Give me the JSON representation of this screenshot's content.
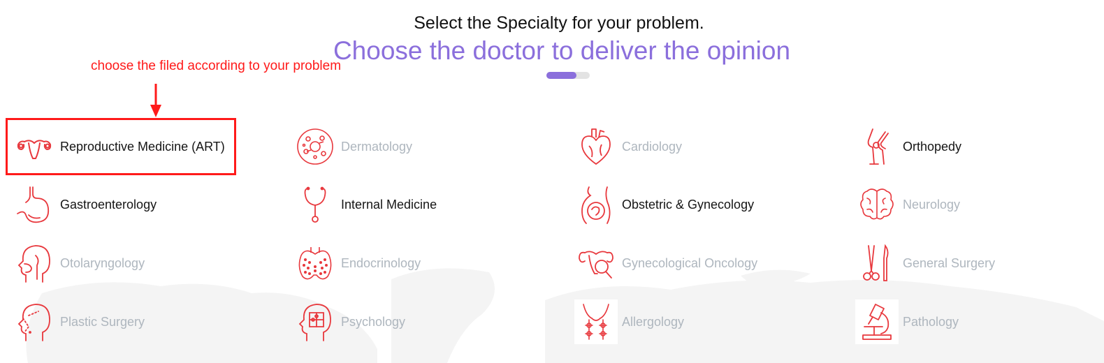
{
  "header": {
    "subtitle": "Select the Specialty for your problem.",
    "title": "Choose the doctor to deliver the opinion",
    "progress_fraction": 0.69
  },
  "annotation": {
    "text": "choose the filed according to your problem",
    "color": "#ff1a1a"
  },
  "colors": {
    "accent": "#8b6fdc",
    "icon": "#e8383d",
    "enabled_text": "#151515",
    "disabled_text": "#aeb6be"
  },
  "specialties": [
    {
      "label": "Reproductive Medicine (ART)",
      "icon": "uterus-icon",
      "enabled": true
    },
    {
      "label": "Dermatology",
      "icon": "skin-cells-icon",
      "enabled": false
    },
    {
      "label": "Cardiology",
      "icon": "heart-icon",
      "enabled": false
    },
    {
      "label": "Orthopedy",
      "icon": "knee-joint-icon",
      "enabled": true
    },
    {
      "label": "Gastroenterology",
      "icon": "stomach-icon",
      "enabled": true
    },
    {
      "label": "Internal Medicine",
      "icon": "stethoscope-icon",
      "enabled": true
    },
    {
      "label": "Obstetric & Gynecology",
      "icon": "pregnant-belly-icon",
      "enabled": true
    },
    {
      "label": "Neurology",
      "icon": "brain-icon",
      "enabled": false
    },
    {
      "label": "Otolaryngology",
      "icon": "head-throat-icon",
      "enabled": false
    },
    {
      "label": "Endocrinology",
      "icon": "thyroid-icon",
      "enabled": false
    },
    {
      "label": "Gynecological Oncology",
      "icon": "uterus-magnifier-icon",
      "enabled": false
    },
    {
      "label": "General Surgery",
      "icon": "surgical-tools-icon",
      "enabled": false
    },
    {
      "label": "Plastic Surgery",
      "icon": "face-marking-icon",
      "enabled": false
    },
    {
      "label": "Psychology",
      "icon": "head-puzzle-icon",
      "enabled": false
    },
    {
      "label": "Allergology",
      "icon": "nose-allergy-icon",
      "enabled": false
    },
    {
      "label": "Pathology",
      "icon": "microscope-icon",
      "enabled": false
    }
  ]
}
